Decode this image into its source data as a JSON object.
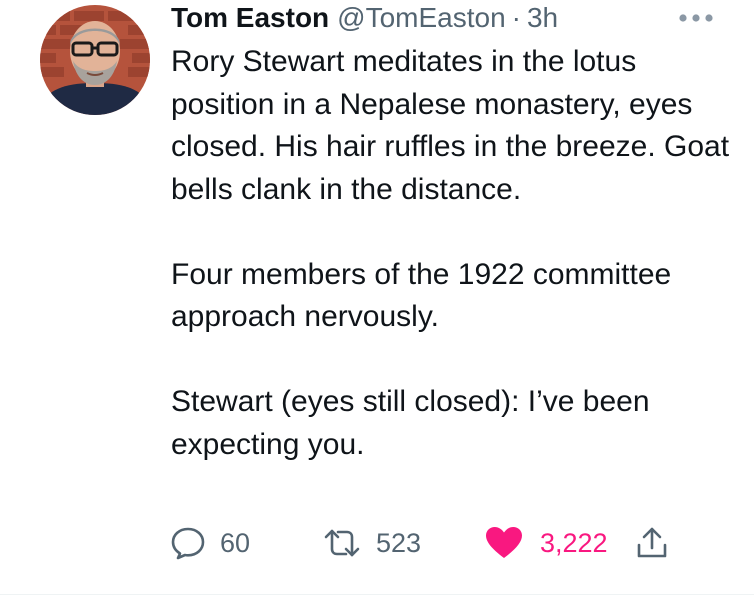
{
  "tweet": {
    "author": {
      "name": "Tom Easton",
      "handle": "@TomEaston",
      "separator": "·",
      "time": "3h"
    },
    "more_icon": "more-horizontal-icon",
    "text": {
      "p1": "Rory Stewart meditates in the lotus position in a Nepalese monastery, eyes closed. His hair ruffles in the breeze. Goat bells clank in the distance.",
      "p2": "Four members of the 1922 committee approach nervously.",
      "p3": "Stewart (eyes still closed): I’ve been expecting you."
    },
    "actions": {
      "reply": {
        "icon": "reply-icon",
        "count": "60"
      },
      "retweet": {
        "icon": "retweet-icon",
        "count": "523"
      },
      "like": {
        "icon": "heart-icon",
        "count": "3,222",
        "liked": true
      },
      "share": {
        "icon": "share-icon"
      }
    },
    "colors": {
      "text": "#0f1419",
      "secondary": "#536471",
      "like": "#f91880"
    }
  }
}
